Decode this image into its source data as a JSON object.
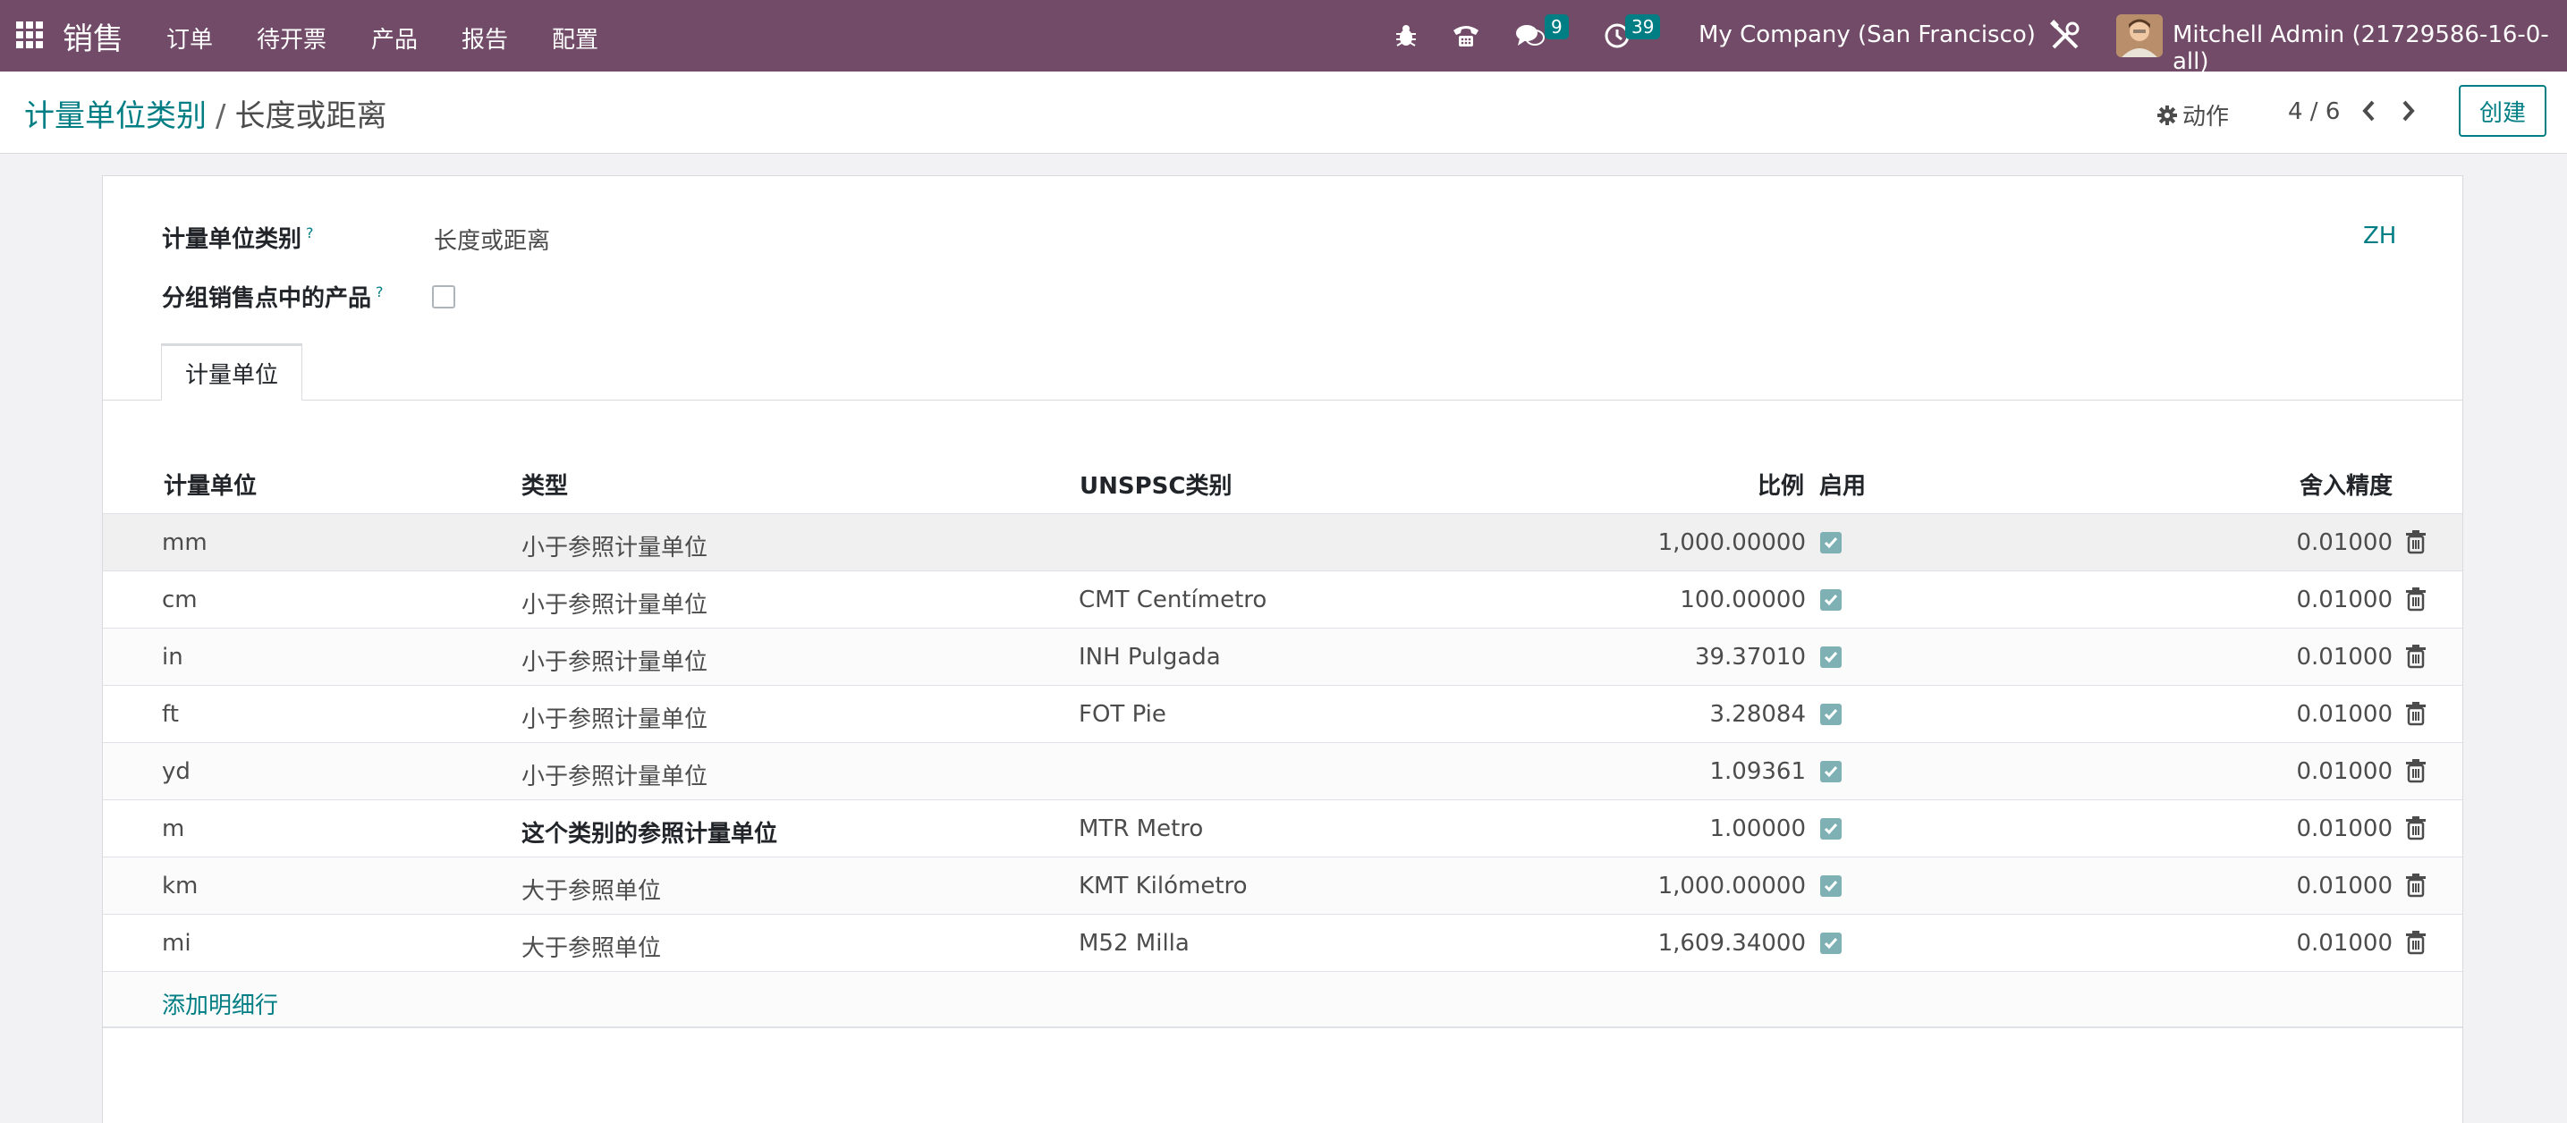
{
  "navbar": {
    "app_name": "销售",
    "menu": [
      "订单",
      "待开票",
      "产品",
      "报告",
      "配置"
    ],
    "messages_count": "9",
    "activities_count": "39",
    "company": "My Company (San Francisco)",
    "user": "Mitchell Admin (21729586-16-0-all)"
  },
  "control": {
    "breadcrumb_parent": "计量单位类别",
    "breadcrumb_sep": "/",
    "breadcrumb_current": "长度或距离",
    "action_label": "动作",
    "pager": "4 / 6",
    "create_label": "创建"
  },
  "form": {
    "category_label": "计量单位类别",
    "category_help": "?",
    "category_value": "长度或距离",
    "group_pos_label": "分组销售点中的产品",
    "group_pos_help": "?",
    "group_pos_checked": false,
    "lang": "ZH",
    "tab_label": "计量单位"
  },
  "table": {
    "headers": {
      "uom": "计量单位",
      "type": "类型",
      "unspsc": "UNSPSC类别",
      "ratio": "比例",
      "active": "启用",
      "rounding": "舍入精度"
    },
    "rows": [
      {
        "uom": "mm",
        "type": "小于参照计量单位",
        "unspsc": "",
        "ratio": "1,000.00000",
        "active": true,
        "rounding": "0.01000"
      },
      {
        "uom": "cm",
        "type": "小于参照计量单位",
        "unspsc": "CMT Centímetro",
        "ratio": "100.00000",
        "active": true,
        "rounding": "0.01000"
      },
      {
        "uom": "in",
        "type": "小于参照计量单位",
        "unspsc": "INH Pulgada",
        "ratio": "39.37010",
        "active": true,
        "rounding": "0.01000"
      },
      {
        "uom": "ft",
        "type": "小于参照计量单位",
        "unspsc": "FOT Pie",
        "ratio": "3.28084",
        "active": true,
        "rounding": "0.01000"
      },
      {
        "uom": "yd",
        "type": "小于参照计量单位",
        "unspsc": "",
        "ratio": "1.09361",
        "active": true,
        "rounding": "0.01000"
      },
      {
        "uom": "m",
        "type": "这个类别的参照计量单位",
        "unspsc": "MTR Metro",
        "ratio": "1.00000",
        "active": true,
        "rounding": "0.01000",
        "bold_type": true
      },
      {
        "uom": "km",
        "type": "大于参照单位",
        "unspsc": "KMT Kilómetro",
        "ratio": "1,000.00000",
        "active": true,
        "rounding": "0.01000"
      },
      {
        "uom": "mi",
        "type": "大于参照单位",
        "unspsc": "M52 Milla",
        "ratio": "1,609.34000",
        "active": true,
        "rounding": "0.01000"
      }
    ],
    "add_line": "添加明细行"
  }
}
